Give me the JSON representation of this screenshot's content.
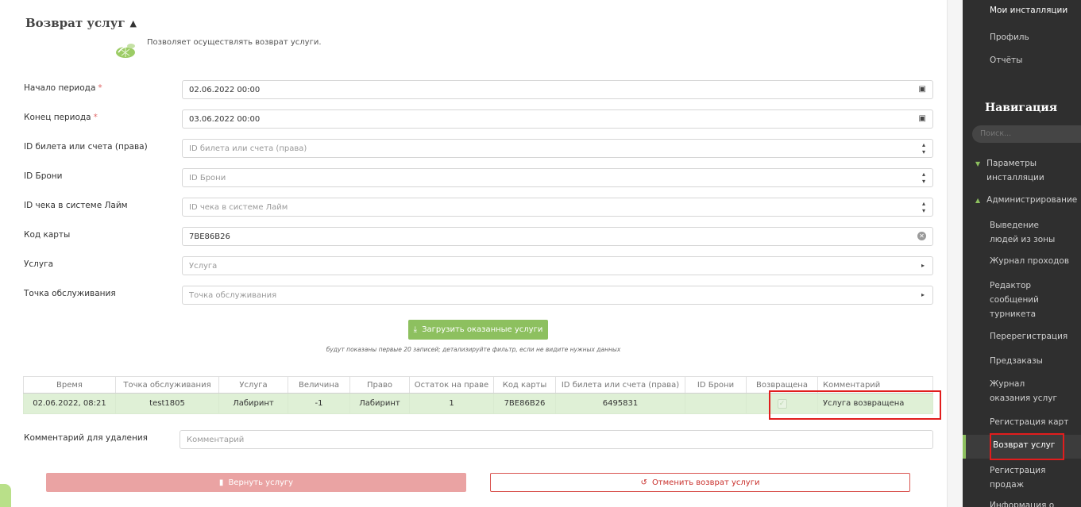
{
  "form": {
    "title": "Возврат услуг",
    "description": "Позволяет осуществлять возврат услуги.",
    "fields": [
      {
        "label": "Начало периода",
        "required": true,
        "value": "02.06.2022 00:00",
        "placeholder": "",
        "icon": "calendar-icon"
      },
      {
        "label": "Конец периода",
        "required": true,
        "value": "03.06.2022 00:00",
        "placeholder": "",
        "icon": "calendar-icon"
      },
      {
        "label": "ID билета или счета (права)",
        "required": false,
        "value": "",
        "placeholder": "ID билета или счета (права)",
        "icon": "spinner-icon"
      },
      {
        "label": "ID Брони",
        "required": false,
        "value": "",
        "placeholder": "ID Брони",
        "icon": "spinner-icon"
      },
      {
        "label": "ID чека в системе Лайм",
        "required": false,
        "value": "",
        "placeholder": "ID чека в системе Лайм",
        "icon": "spinner-icon"
      },
      {
        "label": "Код карты",
        "required": false,
        "value": "7BE86B26",
        "placeholder": "",
        "icon": "clear-icon"
      },
      {
        "label": "Услуга",
        "required": false,
        "value": "",
        "placeholder": "Услуга",
        "icon": "dropdown-arrow-icon"
      },
      {
        "label": "Точка обслуживания",
        "required": false,
        "value": "",
        "placeholder": "Точка обслуживания",
        "icon": "dropdown-arrow-icon"
      }
    ],
    "required_mark": "*",
    "load_button": "Загрузить оказанные услуги",
    "hint": "будут показаны первые 20 записей; детализируйте фильтр, если не видите нужных данных"
  },
  "table": {
    "columns": [
      "Время",
      "Точка обслуживания",
      "Услуга",
      "Величина",
      "Право",
      "Остаток на праве",
      "Код карты",
      "ID билета или счета (права)",
      "ID Брони",
      "Возвращена",
      "Комментарий"
    ],
    "rows": [
      {
        "time": "02.06.2022, 08:21",
        "point": "test1805",
        "service": "Лабиринт",
        "amount": "-1",
        "right": "Лабиринт",
        "remaining": "1",
        "card": "7BE86B26",
        "ticket": "6495831",
        "booking": "",
        "returned": true,
        "comment": "Услуга возвращена"
      }
    ]
  },
  "delete_comment": {
    "label": "Комментарий для удаления",
    "placeholder": "Комментарий"
  },
  "actions": {
    "return_label": "Вернуть услугу",
    "cancel_label": "Отменить возврат услуги"
  },
  "sidebar": {
    "top_item": "Мои инсталляции",
    "items": [
      "Профиль",
      "Отчёты"
    ],
    "nav_title": "Навигация",
    "search_placeholder": "Поиск...",
    "categories": [
      {
        "label": "Параметры инсталляции",
        "expanded": false
      },
      {
        "label": "Администрирование",
        "expanded": true
      }
    ],
    "sub_items": [
      "Выведение людей из зоны",
      "Журнал проходов",
      "Редактор сообщений турникета",
      "Перерегистрация",
      "Предзаказы",
      "Журнал оказания услуг",
      "Регистрация карт",
      "Возврат услуг",
      "Регистрация продаж",
      "Информация о"
    ],
    "active": "Возврат услуг"
  },
  "colors": {
    "accent": "#8dc05f",
    "danger": "#d9534f",
    "row_bg": "#dff0d6",
    "sidebar_bg": "#2f2f2f",
    "highlight": "#e11d1d"
  }
}
